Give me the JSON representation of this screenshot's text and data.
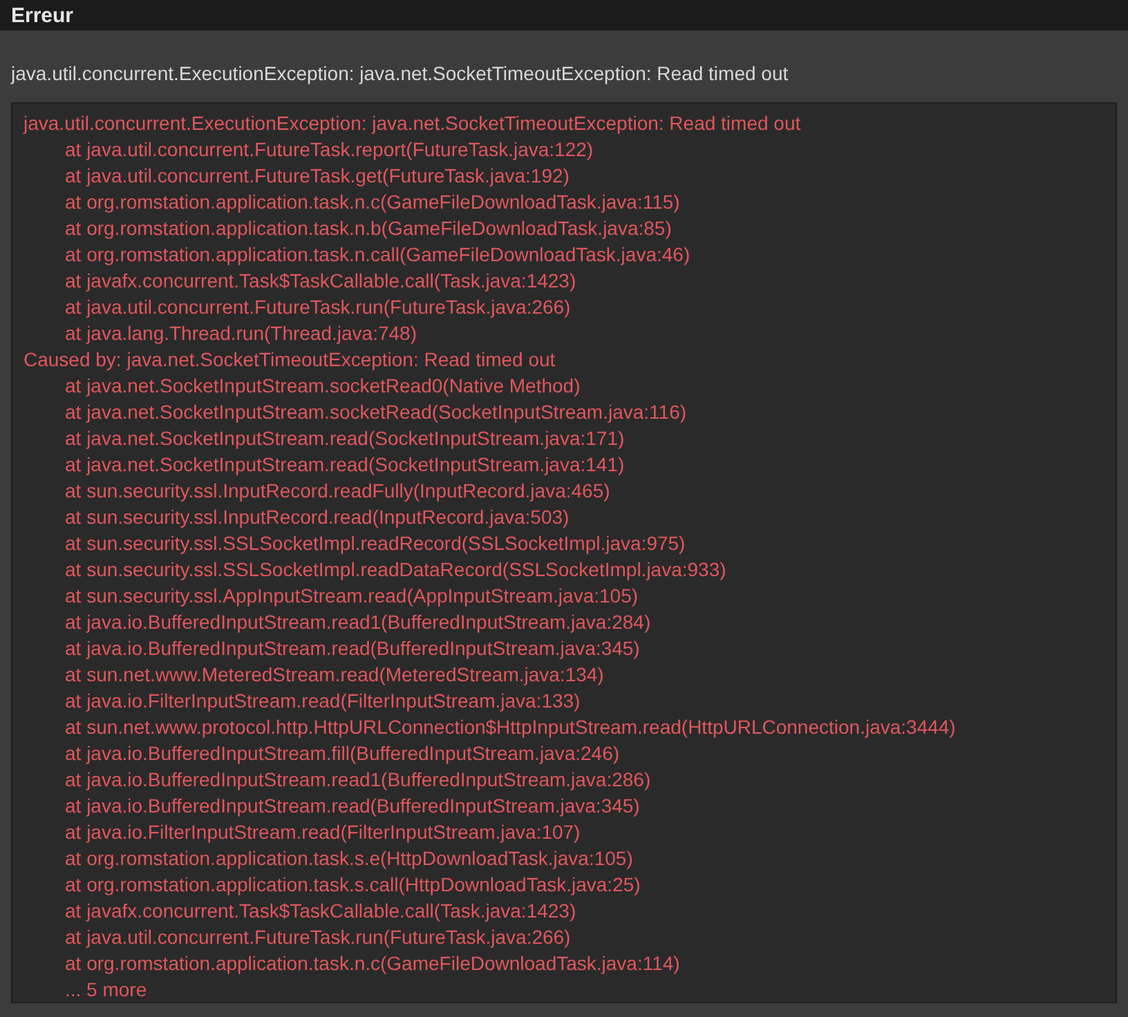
{
  "window": {
    "title": "Erreur"
  },
  "message": "java.util.concurrent.ExecutionException: java.net.SocketTimeoutException: Read timed out",
  "stack_trace": [
    {
      "kind": "header",
      "text": "java.util.concurrent.ExecutionException: java.net.SocketTimeoutException: Read timed out"
    },
    {
      "kind": "frame",
      "text": "at java.util.concurrent.FutureTask.report(FutureTask.java:122)"
    },
    {
      "kind": "frame",
      "text": "at java.util.concurrent.FutureTask.get(FutureTask.java:192)"
    },
    {
      "kind": "frame",
      "text": "at org.romstation.application.task.n.c(GameFileDownloadTask.java:115)"
    },
    {
      "kind": "frame",
      "text": "at org.romstation.application.task.n.b(GameFileDownloadTask.java:85)"
    },
    {
      "kind": "frame",
      "text": "at org.romstation.application.task.n.call(GameFileDownloadTask.java:46)"
    },
    {
      "kind": "frame",
      "text": "at javafx.concurrent.Task$TaskCallable.call(Task.java:1423)"
    },
    {
      "kind": "frame",
      "text": "at java.util.concurrent.FutureTask.run(FutureTask.java:266)"
    },
    {
      "kind": "frame",
      "text": "at java.lang.Thread.run(Thread.java:748)"
    },
    {
      "kind": "header",
      "text": "Caused by: java.net.SocketTimeoutException: Read timed out"
    },
    {
      "kind": "frame",
      "text": "at java.net.SocketInputStream.socketRead0(Native Method)"
    },
    {
      "kind": "frame",
      "text": "at java.net.SocketInputStream.socketRead(SocketInputStream.java:116)"
    },
    {
      "kind": "frame",
      "text": "at java.net.SocketInputStream.read(SocketInputStream.java:171)"
    },
    {
      "kind": "frame",
      "text": "at java.net.SocketInputStream.read(SocketInputStream.java:141)"
    },
    {
      "kind": "frame",
      "text": "at sun.security.ssl.InputRecord.readFully(InputRecord.java:465)"
    },
    {
      "kind": "frame",
      "text": "at sun.security.ssl.InputRecord.read(InputRecord.java:503)"
    },
    {
      "kind": "frame",
      "text": "at sun.security.ssl.SSLSocketImpl.readRecord(SSLSocketImpl.java:975)"
    },
    {
      "kind": "frame",
      "text": "at sun.security.ssl.SSLSocketImpl.readDataRecord(SSLSocketImpl.java:933)"
    },
    {
      "kind": "frame",
      "text": "at sun.security.ssl.AppInputStream.read(AppInputStream.java:105)"
    },
    {
      "kind": "frame",
      "text": "at java.io.BufferedInputStream.read1(BufferedInputStream.java:284)"
    },
    {
      "kind": "frame",
      "text": "at java.io.BufferedInputStream.read(BufferedInputStream.java:345)"
    },
    {
      "kind": "frame",
      "text": "at sun.net.www.MeteredStream.read(MeteredStream.java:134)"
    },
    {
      "kind": "frame",
      "text": "at java.io.FilterInputStream.read(FilterInputStream.java:133)"
    },
    {
      "kind": "frame",
      "text": "at sun.net.www.protocol.http.HttpURLConnection$HttpInputStream.read(HttpURLConnection.java:3444)"
    },
    {
      "kind": "frame",
      "text": "at java.io.BufferedInputStream.fill(BufferedInputStream.java:246)"
    },
    {
      "kind": "frame",
      "text": "at java.io.BufferedInputStream.read1(BufferedInputStream.java:286)"
    },
    {
      "kind": "frame",
      "text": "at java.io.BufferedInputStream.read(BufferedInputStream.java:345)"
    },
    {
      "kind": "frame",
      "text": "at java.io.FilterInputStream.read(FilterInputStream.java:107)"
    },
    {
      "kind": "frame",
      "text": "at org.romstation.application.task.s.e(HttpDownloadTask.java:105)"
    },
    {
      "kind": "frame",
      "text": "at org.romstation.application.task.s.call(HttpDownloadTask.java:25)"
    },
    {
      "kind": "frame",
      "text": "at javafx.concurrent.Task$TaskCallable.call(Task.java:1423)"
    },
    {
      "kind": "frame",
      "text": "at java.util.concurrent.FutureTask.run(FutureTask.java:266)"
    },
    {
      "kind": "frame",
      "text": "at org.romstation.application.task.n.c(GameFileDownloadTask.java:114)"
    },
    {
      "kind": "frame",
      "text": "... 5 more"
    }
  ]
}
